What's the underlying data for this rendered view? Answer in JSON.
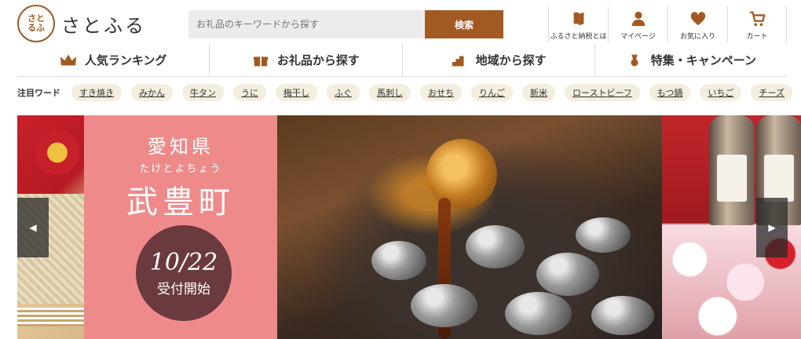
{
  "logo": {
    "mark": "さと\nるふ",
    "text": "さとふる"
  },
  "search": {
    "placeholder": "お礼品のキーワードから探す",
    "button": "検索"
  },
  "utils": [
    {
      "label": "ふるさと納税とは",
      "icon": "book-icon"
    },
    {
      "label": "マイページ",
      "icon": "user-icon"
    },
    {
      "label": "お気に入り",
      "icon": "heart-icon"
    },
    {
      "label": "カート",
      "icon": "cart-icon"
    }
  ],
  "nav": [
    {
      "label": "人気ランキング",
      "icon": "crown-icon"
    },
    {
      "label": "お礼品から探す",
      "icon": "gift-icon"
    },
    {
      "label": "地域から探す",
      "icon": "region-icon"
    },
    {
      "label": "特集・キャンペーン",
      "icon": "medal-icon"
    }
  ],
  "keywords": {
    "label": "注目ワード",
    "items": [
      "すき焼き",
      "みかん",
      "牛タン",
      "うに",
      "梅干し",
      "ふぐ",
      "馬刺し",
      "おせち",
      "りんご",
      "新米",
      "ローストビーフ",
      "もつ鍋",
      "いちご",
      "チーズ"
    ]
  },
  "banner": {
    "prefecture": "愛知県",
    "ruby": "たけとよちょう",
    "town": "武豊町",
    "date": "10/22",
    "status": "受付開始"
  },
  "colors": {
    "brand": "#a25a22",
    "banner_pink": "#ef8a8a",
    "circle": "#6b3a3e",
    "tag_bg": "#f3eedd"
  }
}
